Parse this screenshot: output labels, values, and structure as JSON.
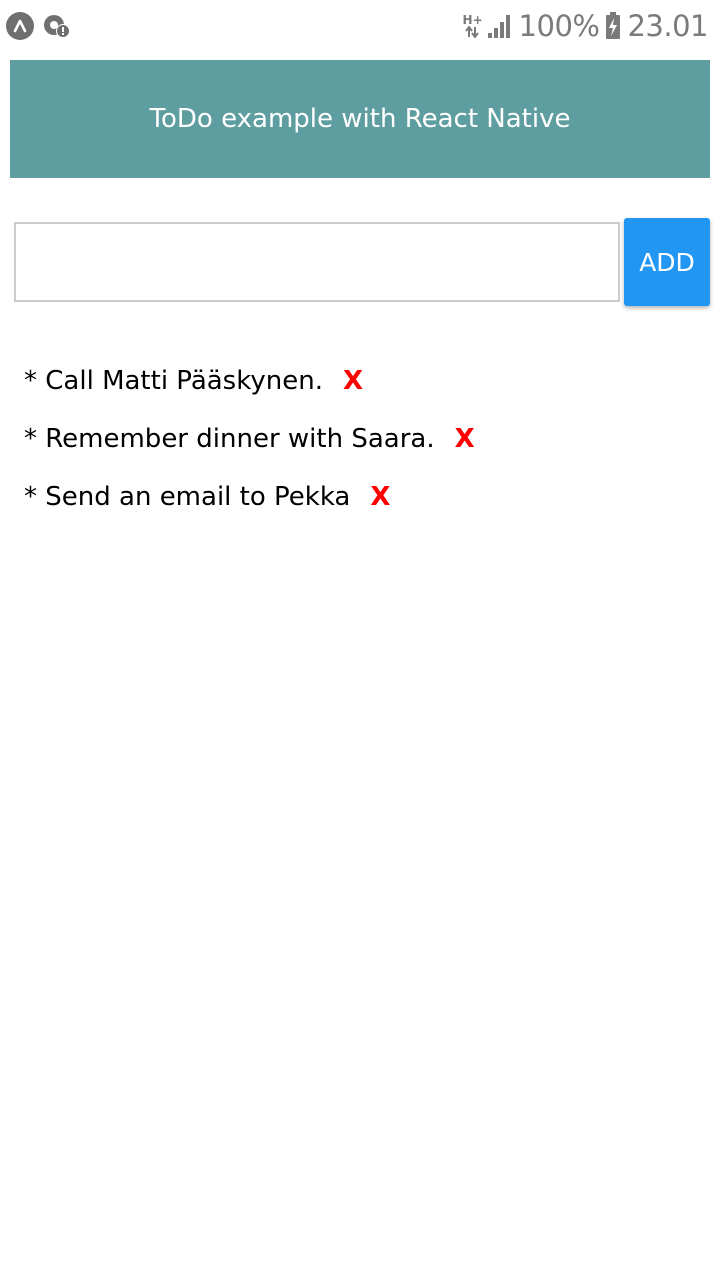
{
  "status_bar": {
    "battery": "100%",
    "time": "23.01",
    "network_type": "H+",
    "icons": [
      "expo-icon",
      "notification-alert-icon",
      "data-transfer-icon",
      "signal-icon",
      "battery-charging-icon"
    ]
  },
  "header": {
    "title": "ToDo example with React Native",
    "background_color": "#5f9ea0"
  },
  "input": {
    "value": "",
    "placeholder": ""
  },
  "add_button": {
    "label": "ADD",
    "color": "#2196f3"
  },
  "todos": [
    {
      "text": "* Call Matti Pääskynen.",
      "delete_label": "X"
    },
    {
      "text": "* Remember dinner with Saara.",
      "delete_label": "X"
    },
    {
      "text": "* Send an email to Pekka",
      "delete_label": "X"
    }
  ],
  "colors": {
    "delete": "#ff0000",
    "status_icons": "#7a7a7a"
  }
}
